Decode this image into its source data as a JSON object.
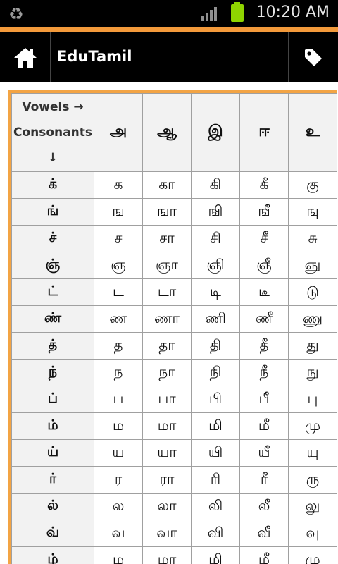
{
  "status_bar": {
    "time": "10:20 AM"
  },
  "action_bar": {
    "title": "EduTamil"
  },
  "table": {
    "corner_vowels": "Vowels →",
    "corner_consonants": "Consonants",
    "corner_arrow": "↓",
    "vowels": [
      "அ",
      "ஆ",
      "இ",
      "ஈ",
      "உ"
    ],
    "rows": [
      {
        "consonant": "க்",
        "cells": [
          "க",
          "கா",
          "கி",
          "கீ",
          "கு"
        ]
      },
      {
        "consonant": "ங்",
        "cells": [
          "ங",
          "ஙா",
          "ஙி",
          "ஙீ",
          "ஙு"
        ]
      },
      {
        "consonant": "ச்",
        "cells": [
          "ச",
          "சா",
          "சி",
          "சீ",
          "சு"
        ]
      },
      {
        "consonant": "ஞ்",
        "cells": [
          "ஞ",
          "ஞா",
          "ஞி",
          "ஞீ",
          "ஞு"
        ]
      },
      {
        "consonant": "ட்",
        "cells": [
          "ட",
          "டா",
          "டி",
          "டீ",
          "டு"
        ]
      },
      {
        "consonant": "ண்",
        "cells": [
          "ண",
          "ணா",
          "ணி",
          "ணீ",
          "ணு"
        ]
      },
      {
        "consonant": "த்",
        "cells": [
          "த",
          "தா",
          "தி",
          "தீ",
          "து"
        ]
      },
      {
        "consonant": "ந்",
        "cells": [
          "ந",
          "நா",
          "நி",
          "நீ",
          "நு"
        ]
      },
      {
        "consonant": "ப்",
        "cells": [
          "ப",
          "பா",
          "பி",
          "பீ",
          "பு"
        ]
      },
      {
        "consonant": "ம்",
        "cells": [
          "ம",
          "மா",
          "மி",
          "மீ",
          "மு"
        ]
      },
      {
        "consonant": "ய்",
        "cells": [
          "ய",
          "யா",
          "யி",
          "யீ",
          "யு"
        ]
      },
      {
        "consonant": "ர்",
        "cells": [
          "ர",
          "ரா",
          "ரி",
          "ரீ",
          "ரு"
        ]
      },
      {
        "consonant": "ல்",
        "cells": [
          "ல",
          "லா",
          "லி",
          "லீ",
          "லு"
        ]
      },
      {
        "consonant": "வ்",
        "cells": [
          "வ",
          "வா",
          "வி",
          "வீ",
          "வு"
        ]
      },
      {
        "consonant": "ழ்",
        "cells": [
          "ழ",
          "ழா",
          "ழி",
          "ழீ",
          "ழு"
        ]
      }
    ]
  }
}
